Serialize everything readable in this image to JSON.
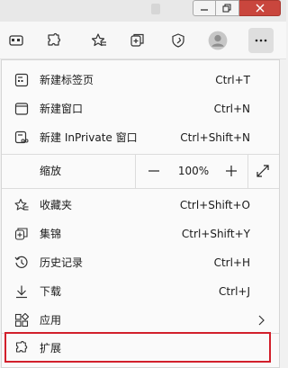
{
  "window": {
    "minimize_glyph": "—",
    "maximize_glyph": "⧉",
    "close_glyph": "✕"
  },
  "toolbar": {
    "buttons": [
      {
        "name": "collections-split-icon"
      },
      {
        "name": "extensions-icon"
      },
      {
        "name": "favorites-icon"
      },
      {
        "name": "collections-icon"
      },
      {
        "name": "browser-essentials-icon"
      },
      {
        "name": "profile-avatar"
      },
      {
        "name": "more-icon"
      }
    ]
  },
  "menu": {
    "new_tab": {
      "label": "新建标签页",
      "shortcut": "Ctrl+T"
    },
    "new_window": {
      "label": "新建窗口",
      "shortcut": "Ctrl+N"
    },
    "new_inprivate": {
      "label": "新建 InPrivate 窗口",
      "shortcut": "Ctrl+Shift+N"
    },
    "zoom": {
      "label": "缩放",
      "minus": "—",
      "value": "100%",
      "plus": "+"
    },
    "favorites": {
      "label": "收藏夹",
      "shortcut": "Ctrl+Shift+O"
    },
    "collections": {
      "label": "集锦",
      "shortcut": "Ctrl+Shift+Y"
    },
    "history": {
      "label": "历史记录",
      "shortcut": "Ctrl+H"
    },
    "downloads": {
      "label": "下载",
      "shortcut": "Ctrl+J"
    },
    "apps": {
      "label": "应用"
    },
    "extensions": {
      "label": "扩展"
    }
  },
  "colors": {
    "highlight_border": "#d21f2b",
    "close_button": "#c9463d"
  }
}
